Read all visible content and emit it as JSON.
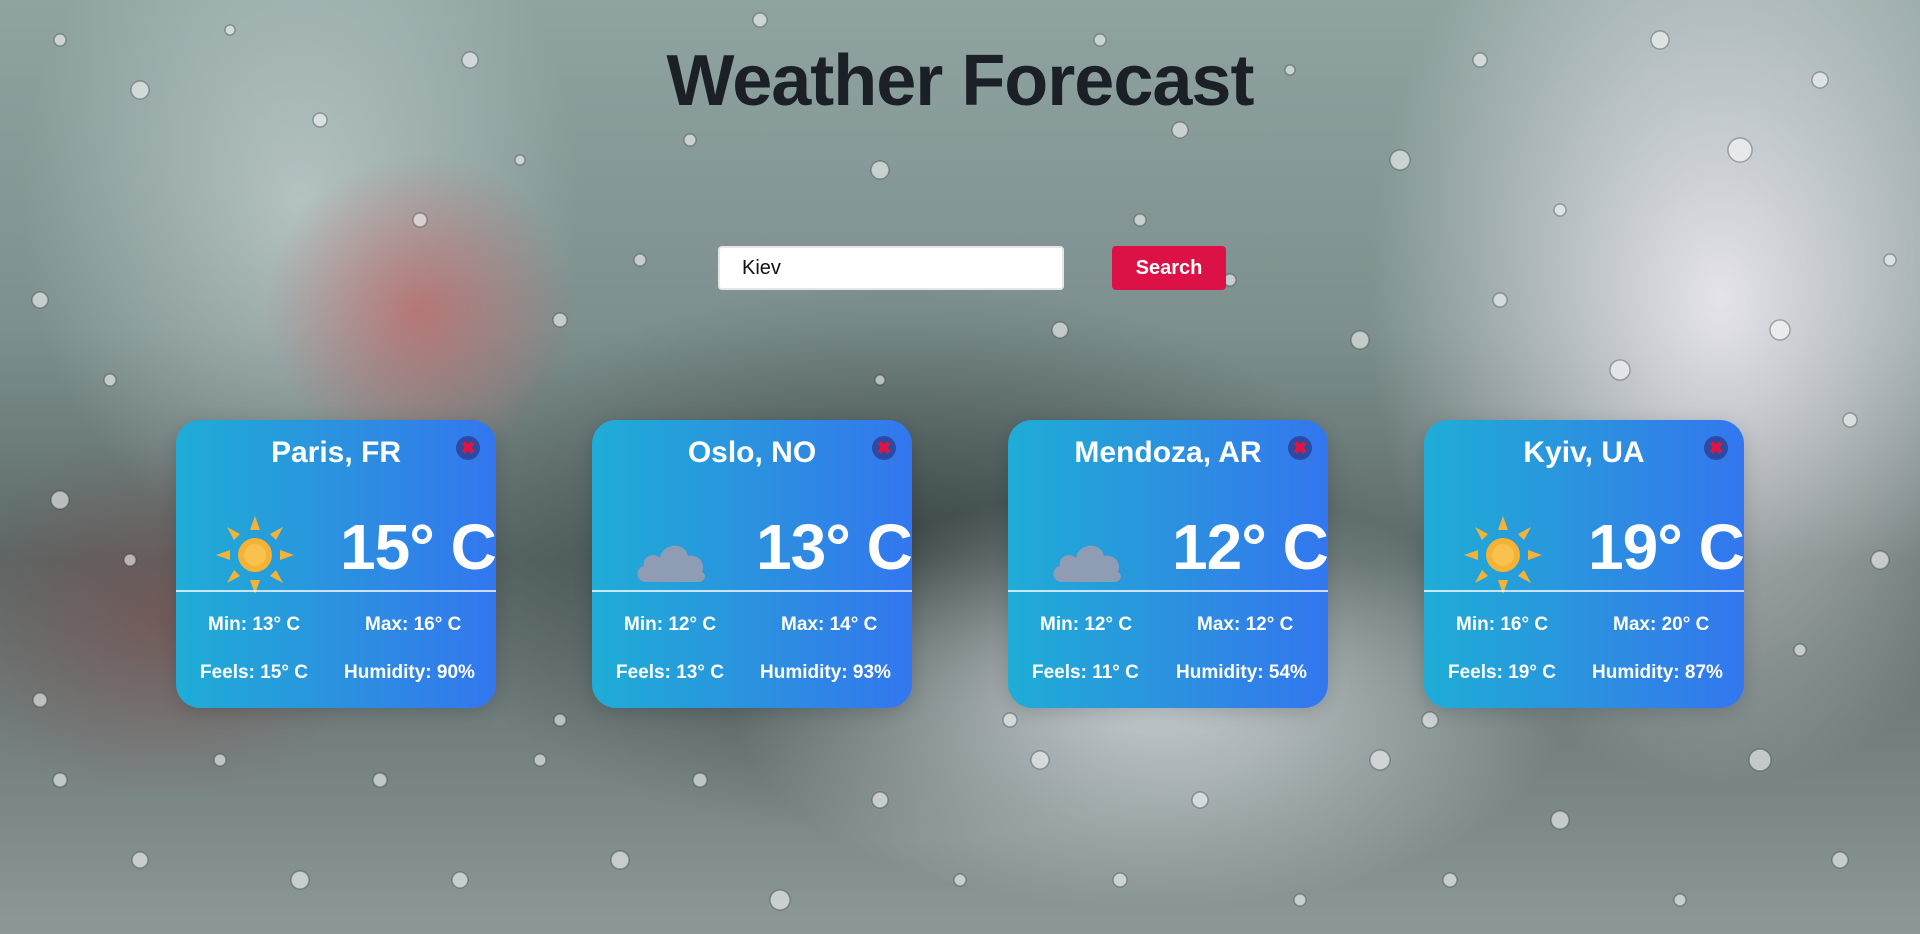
{
  "header": {
    "title": "Weather Forecast"
  },
  "search": {
    "value": "Kiev",
    "button_label": "Search"
  },
  "cards": [
    {
      "city": "Paris, FR",
      "icon": "sun-icon",
      "temp": "15° C",
      "min": "Min: 13° C",
      "max": "Max: 16° C",
      "feels": "Feels: 15° C",
      "humidity": "Humidity: 90%",
      "close": "✖"
    },
    {
      "city": "Oslo, NO",
      "icon": "cloud-icon",
      "temp": "13° C",
      "min": "Min: 12° C",
      "max": "Max: 14° C",
      "feels": "Feels: 13° C",
      "humidity": "Humidity: 93%",
      "close": "✖"
    },
    {
      "city": "Mendoza, AR",
      "icon": "cloud-icon",
      "temp": "12° C",
      "min": "Min: 12° C",
      "max": "Max: 12° C",
      "feels": "Feels: 11° C",
      "humidity": "Humidity: 54%",
      "close": "✖"
    },
    {
      "city": "Kyiv, UA",
      "icon": "sun-icon",
      "temp": "19° C",
      "min": "Min: 16° C",
      "max": "Max: 20° C",
      "feels": "Feels: 19° C",
      "humidity": "Humidity: 87%",
      "close": "✖"
    }
  ],
  "colors": {
    "search_button": "#dc1146",
    "card_gradient_start": "#1fadd6",
    "card_gradient_end": "#3376ef",
    "sun": "#f5b335",
    "cloud": "#8e9db4",
    "title": "#1b1f26"
  }
}
